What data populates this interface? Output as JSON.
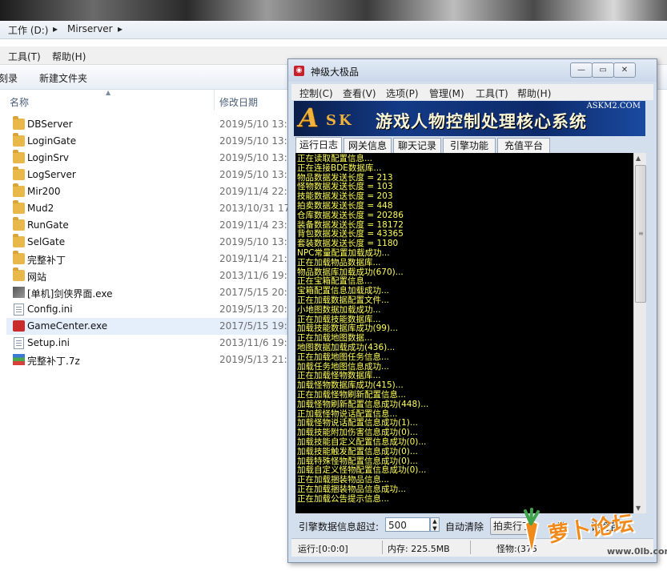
{
  "explorer": {
    "breadcrumb": [
      "工作 (D:)",
      "Mirserver"
    ],
    "menu": [
      "工具(T)",
      "帮助(H)"
    ],
    "toolbar": {
      "burn_fragment": "刻录",
      "new_folder": "新建文件夹"
    },
    "columns": {
      "name": "名称",
      "modified": "修改日期"
    },
    "files": [
      {
        "name": "DBServer",
        "date": "2019/5/10 13:3",
        "icon": "folder-icon"
      },
      {
        "name": "LoginGate",
        "date": "2019/5/10 13:3",
        "icon": "folder-icon"
      },
      {
        "name": "LoginSrv",
        "date": "2019/5/10 13:3",
        "icon": "folder-icon"
      },
      {
        "name": "LogServer",
        "date": "2019/5/10 13:3",
        "icon": "folder-icon"
      },
      {
        "name": "Mir200",
        "date": "2019/11/4 22:2",
        "icon": "folder-icon"
      },
      {
        "name": "Mud2",
        "date": "2013/10/31 17",
        "icon": "folder-icon"
      },
      {
        "name": "RunGate",
        "date": "2019/11/4 23:0",
        "icon": "folder-icon"
      },
      {
        "name": "SelGate",
        "date": "2019/5/10 13:3",
        "icon": "folder-icon"
      },
      {
        "name": "完整补丁",
        "date": "2019/11/4 21:4",
        "icon": "folder-icon"
      },
      {
        "name": "网站",
        "date": "2013/11/6 19:5",
        "icon": "folder-icon"
      },
      {
        "name": "[单机]剑侠界面.exe",
        "date": "2017/5/15 20:4",
        "icon": "exe-icon"
      },
      {
        "name": "Config.ini",
        "date": "2019/5/13 20:4",
        "icon": "ini-file-icon"
      },
      {
        "name": "GameCenter.exe",
        "date": "2017/5/15 19:0",
        "icon": "gamecenter-icon"
      },
      {
        "name": "Setup.ini",
        "date": "2013/11/6 19:5",
        "icon": "ini-file-icon"
      },
      {
        "name": "完整补丁.7z",
        "date": "2019/5/13 21:0",
        "icon": "archive-icon"
      }
    ]
  },
  "app": {
    "title": "神级大极品",
    "menu": [
      "控制(C)",
      "查看(V)",
      "选项(P)",
      "管理(M)",
      "工具(T)",
      "帮助(H)"
    ],
    "banner": {
      "logo": "A",
      "logo_rest": "SK",
      "title": "游戏人物控制处理核心系统",
      "url": "ASKM2.COM"
    },
    "tabs": [
      "运行日志",
      "网关信息",
      "聊天记录",
      "引擎功能",
      "充值平台"
    ],
    "active_tab": 0,
    "log": [
      "正在读取配置信息...",
      "正在连接BDE数据库...",
      "物品数据发送长度 = 213",
      "怪物数据发送长度 = 103",
      "技能数据发送长度 = 203",
      "拍卖数据发送长度 = 448",
      "仓库数据发送长度 = 20286",
      "装备数据发送长度 = 18172",
      "背包数据发送长度 = 43365",
      "套装数据发送长度 = 1180",
      "NPC常量配置加载成功...",
      "正在加载物品数据库...",
      "物品数据库加载成功(670)...",
      "正在宝箱配置信息...",
      "宝箱配置信息加载成功...",
      "正在加载数据配置文件...",
      "小地图数据加载成功...",
      "正在加载技能数据库...",
      "加载技能数据库成功(99)...",
      "正在加载地图数据...",
      "地图数据加载成功(436)...",
      "正在加载地图任务信息...",
      "加载任务地图信息成功...",
      "正在加载怪物数据库...",
      "加载怪物数据库成功(415)...",
      "正在加载怪物刷新配置信息...",
      "加载怪物刷新配置信息成功(448)...",
      "正加载怪物说话配置信息...",
      "加载怪物说话配置信息成功(1)...",
      "加载技能附加伤害信息成功(0)...",
      "加载技能自定义配置信息成功(0)...",
      "加载技能触发配置信息成功(0)...",
      "加载特殊怪物配置信息成功(0)...",
      "加载自定义怪物配置信息成功(0)...",
      "正在加载捆装物品信息...",
      "正在加载捆装物品信息成功...",
      "正在加载公告提示信息..."
    ],
    "controls": {
      "threshold_label": "引擎数据信息超过:",
      "threshold_value": "500",
      "auto_clear": "自动清除",
      "auction_btn": "拍卖行丁",
      "fragment_a": "略",
      "settings_fragment": "设置目"
    },
    "status": {
      "running": "运行:[0:0:0]",
      "memory": "内存: 225.5MB",
      "monsters": "怪物:(375"
    }
  },
  "watermark": {
    "text": "萝卜论坛",
    "url": "www.0lb.com"
  }
}
